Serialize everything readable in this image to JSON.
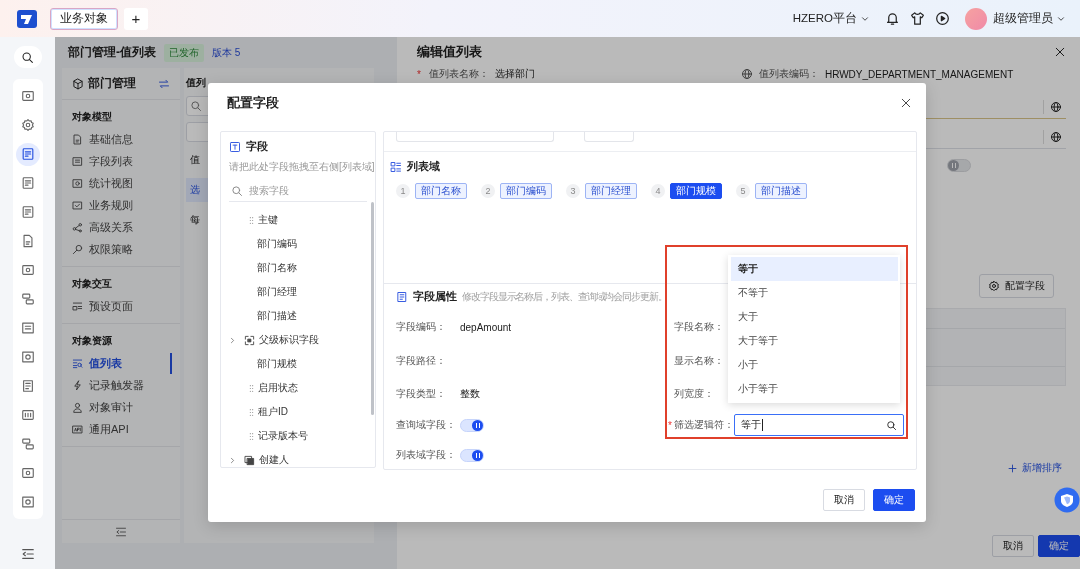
{
  "topbar": {
    "tabs": [
      {
        "label": "业务对象",
        "selected": true
      }
    ],
    "add_tab": "+",
    "platform": "HZERO平台",
    "user": "超级管理员"
  },
  "rail": {
    "items": [
      {
        "selected": false
      },
      {
        "selected": false
      },
      {
        "selected": true
      },
      {
        "selected": false
      },
      {
        "selected": false
      },
      {
        "selected": false
      },
      {
        "selected": false
      },
      {
        "selected": false
      },
      {
        "selected": false
      },
      {
        "selected": false
      },
      {
        "selected": false
      },
      {
        "selected": false
      },
      {
        "selected": false
      },
      {
        "selected": false
      },
      {
        "selected": false
      }
    ]
  },
  "page": {
    "title": "部门管理-值列表",
    "status": "已发布",
    "version": "版本 5"
  },
  "sidebar": {
    "title": "部门管理",
    "sections": [
      {
        "heading": "对象模型",
        "items": [
          {
            "label": "基础信息",
            "selected": false
          },
          {
            "label": "字段列表",
            "selected": false
          },
          {
            "label": "统计视图",
            "selected": false
          },
          {
            "label": "业务规则",
            "selected": false
          },
          {
            "label": "高级关系",
            "selected": false
          },
          {
            "label": "权限策略",
            "selected": false
          }
        ]
      },
      {
        "heading": "对象交互",
        "items": [
          {
            "label": "预设页面",
            "selected": false
          }
        ]
      },
      {
        "heading": "对象资源",
        "items": [
          {
            "label": "值列表",
            "selected": true
          },
          {
            "label": "记录触发器",
            "selected": false
          },
          {
            "label": "对象审计",
            "selected": false
          },
          {
            "label": "通用API",
            "selected": false
          }
        ]
      }
    ]
  },
  "list_panel": {
    "title": "值列",
    "rows": [
      {
        "text": "值",
        "selected": false
      },
      {
        "text": "选",
        "selected": true
      },
      {
        "text": "每",
        "selected": false
      }
    ]
  },
  "drawer": {
    "title": "编辑值列表",
    "fields": [
      {
        "required_mark": "*",
        "label": "值列表名称：",
        "value": "选择部门"
      },
      {
        "label": "值列表编码：",
        "value": "HRWDY_DEPARTMENT_MANAGEMENT"
      }
    ],
    "toggle_on": false,
    "config_button": "配置字段",
    "add_sort": "新增排序",
    "buttons": [
      {
        "label": "取消",
        "kind": "default"
      },
      {
        "label": "确定",
        "kind": "primary"
      }
    ]
  },
  "modal": {
    "title": "配置字段",
    "fields_panel": {
      "title": "字段",
      "hint": "请把此处字段拖拽至右侧[列表域]",
      "search_placeholder": "搜索字段",
      "items": [
        {
          "label": "主键",
          "kind": "draggable"
        },
        {
          "label": "部门编码",
          "kind": "placed"
        },
        {
          "label": "部门名称",
          "kind": "placed"
        },
        {
          "label": "部门经理",
          "kind": "placed"
        },
        {
          "label": "部门描述",
          "kind": "placed"
        },
        {
          "label": "父级标识字段",
          "kind": "group",
          "expanded": false
        },
        {
          "label": "部门规模",
          "kind": "placed"
        },
        {
          "label": "启用状态",
          "kind": "draggable"
        },
        {
          "label": "租户ID",
          "kind": "draggable"
        },
        {
          "label": "记录版本号",
          "kind": "draggable"
        },
        {
          "label": "创建人",
          "kind": "group",
          "expanded": false
        }
      ]
    },
    "list_domain": {
      "title": "列表域",
      "columns": [
        {
          "index": "1",
          "label": "部门名称",
          "selected": false
        },
        {
          "index": "2",
          "label": "部门编码",
          "selected": false
        },
        {
          "index": "3",
          "label": "部门经理",
          "selected": false
        },
        {
          "index": "4",
          "label": "部门规模",
          "selected": true
        },
        {
          "index": "5",
          "label": "部门描述",
          "selected": false
        }
      ]
    },
    "properties": {
      "title": "字段属性",
      "hint": "修改字段显示名称后，列表、查询域均会同步更新。",
      "left": [
        {
          "label": "字段编码：",
          "kind": "text",
          "value": "depAmount"
        },
        {
          "label": "字段路径：",
          "kind": "text"
        },
        {
          "label": "字段类型：",
          "kind": "text",
          "value": "整数"
        },
        {
          "label": "查询域字段：",
          "kind": "switch",
          "on": true
        },
        {
          "label": "列表域字段：",
          "kind": "switch",
          "on": true
        }
      ],
      "right": [
        {
          "label": "字段名称：",
          "kind": "text"
        },
        {
          "label": "显示名称：",
          "kind": "text"
        },
        {
          "label": "列宽度：",
          "kind": "text"
        },
        {
          "required_mark": "*",
          "label": "筛选逻辑符：",
          "kind": "select",
          "value": "等于"
        }
      ]
    },
    "dropdown": {
      "options": [
        {
          "label": "等于",
          "selected": true
        },
        {
          "label": "不等于",
          "selected": false
        },
        {
          "label": "大于",
          "selected": false
        },
        {
          "label": "大于等于",
          "selected": false
        },
        {
          "label": "小于",
          "selected": false
        },
        {
          "label": "小于等于",
          "selected": false
        }
      ]
    },
    "buttons": [
      {
        "label": "取消",
        "kind": "default"
      },
      {
        "label": "确定",
        "kind": "primary"
      }
    ]
  }
}
